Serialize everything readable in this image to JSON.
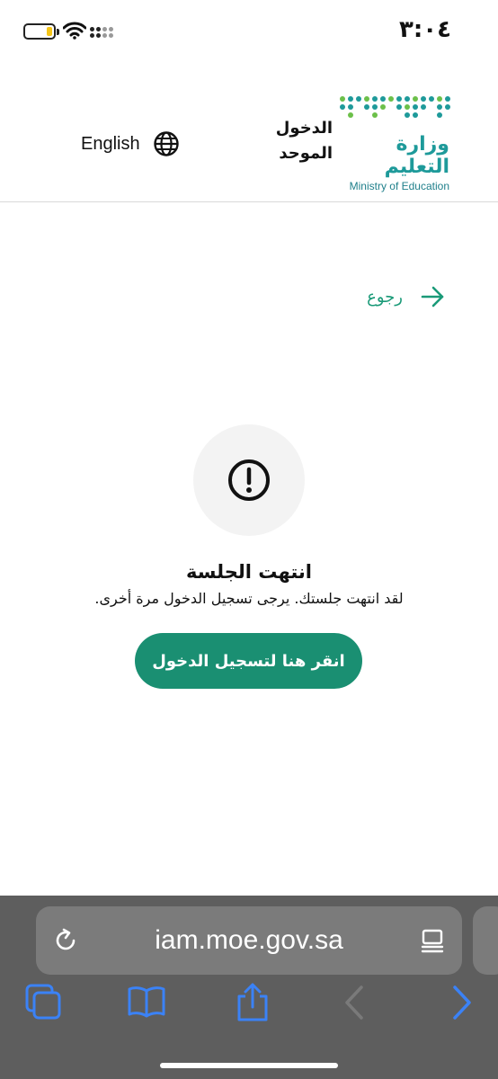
{
  "status_bar": {
    "time": "٣:٠٤",
    "battery_level": 0.2,
    "battery_color": "#f5c518"
  },
  "header": {
    "language_button": "English",
    "sso_title_line1": "الدخول",
    "sso_title_line2": "الموحد",
    "logo_arabic": "وزارة التعليم",
    "logo_english": "Ministry of Education",
    "logo_colors": [
      "#1e9a9a",
      "#6cc04a"
    ]
  },
  "back_link": {
    "label": "رجوع",
    "icon": "arrow-right-icon",
    "color": "#1a9a78"
  },
  "session": {
    "icon": "alert-circle-icon",
    "title": "انتهت الجلسة",
    "message": "لقد انتهت جلستك. يرجى تسجيل الدخول مرة أخرى.",
    "login_button": "انقر هنا لتسجيل الدخول",
    "button_color": "#1a8f72"
  },
  "browser": {
    "url": "iam.moe.gov.sa",
    "toolbar_icons": [
      "tabs-icon",
      "bookmarks-icon",
      "share-icon",
      "back-icon",
      "forward-icon"
    ],
    "accent_color": "#3b82f6"
  }
}
